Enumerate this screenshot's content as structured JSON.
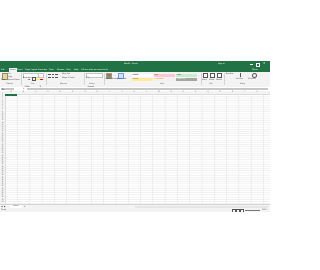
{
  "window": {
    "title": "Book1 - Excel",
    "user": "Sign in",
    "share": "Share"
  },
  "ribbon_tabs": [
    "File",
    "Home",
    "Insert",
    "Page Layout",
    "Formulas",
    "Data",
    "Review",
    "View",
    "Help",
    "Tell me what you want to do"
  ],
  "active_tab": "Home",
  "ribbon": {
    "clipboard": {
      "paste": "Paste",
      "cut": "Cut",
      "copy": "Copy",
      "format_painter": "Format Painter",
      "group": "Clipboard"
    },
    "font": {
      "name": "Calibri",
      "size": "11",
      "group": "Font"
    },
    "alignment": {
      "wrap": "Wrap Text",
      "merge": "Merge & Center",
      "group": "Alignment"
    },
    "number": {
      "format": "General",
      "group": "Number"
    },
    "styles": {
      "conditional": "Conditional Formatting",
      "format_table": "Format as Table",
      "cells": [
        {
          "label": "Normal",
          "bg": "#ffffff",
          "fg": "#000000"
        },
        {
          "label": "Bad",
          "bg": "#ffc7ce",
          "fg": "#9c0006"
        },
        {
          "label": "Good",
          "bg": "#c6efce",
          "fg": "#006100"
        },
        {
          "label": "Neutral",
          "bg": "#ffeb9c",
          "fg": "#9c5700"
        },
        {
          "label": "Calculation",
          "bg": "#f2f2f2",
          "fg": "#fa7d00"
        },
        {
          "label": "Check Cell",
          "bg": "#a5a5a5",
          "fg": "#ffffff"
        }
      ],
      "group": "Styles"
    },
    "cells": {
      "insert": "Insert",
      "delete": "Delete",
      "format": "Format",
      "group": "Cells"
    },
    "editing": {
      "autosum": "AutoSum",
      "sort": "Sort & Filter",
      "find": "Find & Select",
      "group": "Editing"
    }
  },
  "formula_bar": {
    "name_box": "A1",
    "fx": "fx",
    "value": ""
  },
  "columns": [
    "A",
    "B",
    "C",
    "D",
    "E",
    "F",
    "G",
    "H",
    "I",
    "J",
    "K",
    "L",
    "M",
    "N",
    "O",
    "P",
    "Q",
    "R",
    "S",
    "T",
    "U"
  ],
  "rows": [
    "1",
    "2",
    "3",
    "4",
    "5",
    "6",
    "7",
    "8",
    "9",
    "10",
    "11",
    "12",
    "13",
    "14",
    "15",
    "16",
    "17",
    "18",
    "19",
    "20",
    "21",
    "22",
    "23",
    "24",
    "25",
    "26",
    "27",
    "28",
    "29",
    "30",
    "31",
    "32",
    "33",
    "34",
    "35",
    "36",
    "37",
    "38",
    "39",
    "40",
    "41",
    "42",
    "43",
    "44",
    "45",
    "46",
    "47",
    "48",
    "49",
    "50"
  ],
  "sheet": {
    "tab": "Sheet1",
    "add": "+"
  },
  "status": {
    "ready": "Ready",
    "zoom": "100%"
  },
  "colors": {
    "accent": "#217346",
    "ribbon_bg": "#f3f3f3",
    "grid": "#e1e1e1"
  }
}
